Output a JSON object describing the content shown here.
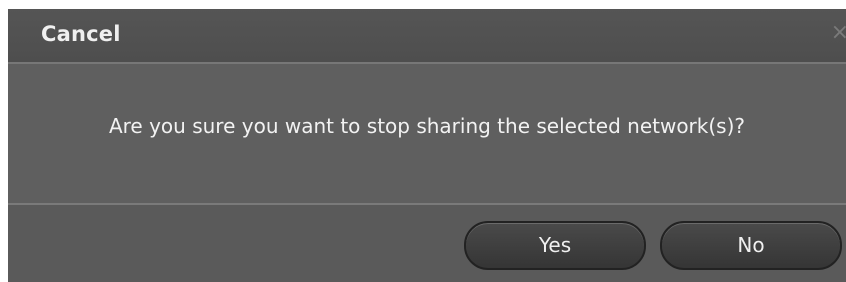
{
  "dialog": {
    "title": "Cancel",
    "close_glyph": "×",
    "message": "Are you sure you want to stop sharing the selected network(s)?",
    "buttons": {
      "yes_label": "Yes",
      "no_label": "No"
    }
  },
  "colors": {
    "dialog_bg": "#5c5c5c",
    "text": "#f2f2f2",
    "button_bg": "#3d3d3d"
  }
}
